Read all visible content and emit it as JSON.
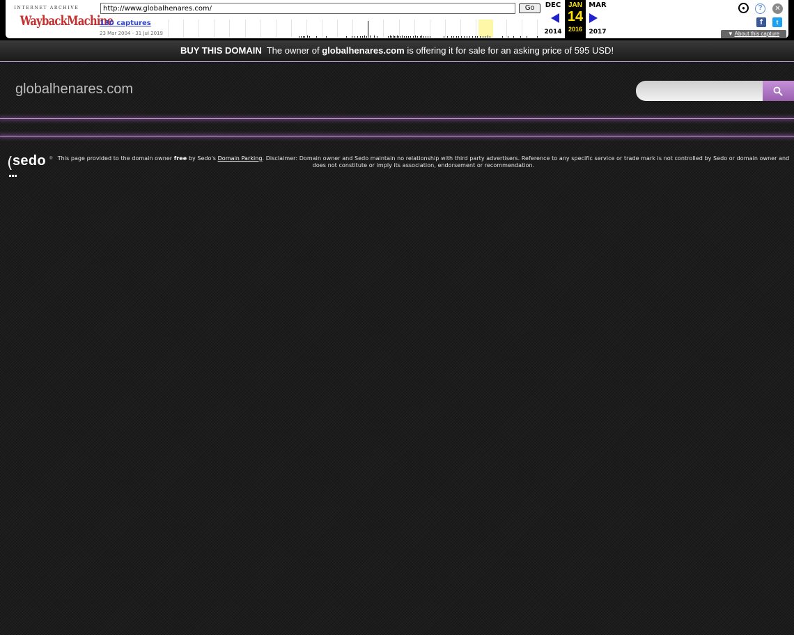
{
  "wayback": {
    "logo_top": "INTERNET ARCHIVE",
    "logo_main": "WaybackMachine",
    "url_value": "http://www.globalhenares.com/",
    "go_label": "Go",
    "captures_label": "130 captures",
    "date_range": "23 Mar 2004 - 31 Jul 2019",
    "prev_month": "DEC",
    "prev_year": "2014",
    "current_month": "JAN",
    "current_day": "14",
    "current_year": "2016",
    "next_month": "MAR",
    "next_year": "2017",
    "about_label": "About this capture",
    "icons": [
      "user-icon",
      "help-icon",
      "close-icon",
      "facebook-icon",
      "twitter-icon"
    ]
  },
  "banner": {
    "buy_label": "BUY THIS DOMAIN",
    "text_before": "The owner of",
    "domain": "globalhenares.com",
    "text_after": "is offering it for sale for an asking price of 595 USD!"
  },
  "header": {
    "site_title": "globalhenares.com",
    "search_placeholder": ""
  },
  "footer": {
    "logo_text": "sedo",
    "text_1": "This page provided to the domain owner",
    "free": "free",
    "text_2": "by Sedo's",
    "link_label": "Domain Parking",
    "text_3": ". Disclaimer: Domain owner and Sedo maintain no relationship with third party advertisers. Reference to any specific service or trade mark is not controlled by Sedo or domain owner and does not constitute or imply its association, endorsement or recommendation."
  },
  "colors": {
    "accent": "#c592d8",
    "page_bg": "#1c1c1c",
    "highlight_year": "#ffe500"
  }
}
